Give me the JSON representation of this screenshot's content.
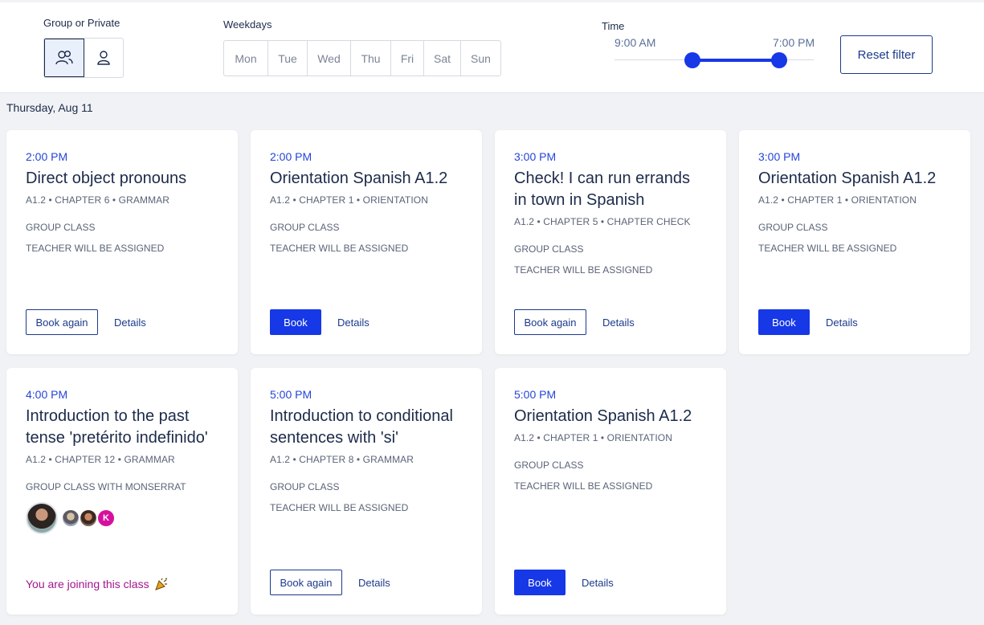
{
  "filters": {
    "mode_label": "Group or Private",
    "mode_icons": [
      "group-icon",
      "person-icon"
    ],
    "weekdays_label": "Weekdays",
    "weekdays": [
      "Mon",
      "Tue",
      "Wed",
      "Thu",
      "Fri",
      "Sat",
      "Sun"
    ],
    "time_label": "Time",
    "time_start": "9:00 AM",
    "time_end": "7:00 PM",
    "reset_label": "Reset filter"
  },
  "date_heading": "Thursday, Aug 11",
  "cards": [
    {
      "time": "2:00 PM",
      "title": "Direct object pronouns",
      "meta": "A1.2 • CHAPTER 6 • GRAMMAR",
      "type": "GROUP CLASS",
      "teacher": "TEACHER WILL BE ASSIGNED",
      "primary": "Book again",
      "details": "Details"
    },
    {
      "time": "2:00 PM",
      "title": "Orientation Spanish A1.2",
      "meta": "A1.2 • CHAPTER 1 • ORIENTATION",
      "type": "GROUP CLASS",
      "teacher": "TEACHER WILL BE ASSIGNED",
      "primary": "Book",
      "details": "Details"
    },
    {
      "time": "3:00 PM",
      "title": "Check! I can run errands in town in Spanish",
      "meta": "A1.2 • CHAPTER 5 • CHAPTER CHECK",
      "type": "GROUP CLASS",
      "teacher": "TEACHER WILL BE ASSIGNED",
      "primary": "Book again",
      "details": "Details"
    },
    {
      "time": "3:00 PM",
      "title": "Orientation Spanish A1.2",
      "meta": "A1.2 • CHAPTER 1 • ORIENTATION",
      "type": "GROUP CLASS",
      "teacher": "TEACHER WILL BE ASSIGNED",
      "primary": "Book",
      "details": "Details"
    },
    {
      "time": "4:00 PM",
      "title": "Introduction to the past tense 'pretérito indefinido'",
      "meta": "A1.2 • CHAPTER 12 • GRAMMAR",
      "type": "GROUP CLASS WITH MONSERRAT",
      "avatar_initial": "K",
      "joining": "You are joining this class"
    },
    {
      "time": "5:00 PM",
      "title": "Introduction to conditional sentences with 'si'",
      "meta": "A1.2 • CHAPTER 8 • GRAMMAR",
      "type": "GROUP CLASS",
      "teacher": "TEACHER WILL BE ASSIGNED",
      "primary": "Book again",
      "details": "Details"
    },
    {
      "time": "5:00 PM",
      "title": "Orientation Spanish A1.2",
      "meta": "A1.2 • CHAPTER 1 • ORIENTATION",
      "type": "GROUP CLASS",
      "teacher": "TEACHER WILL BE ASSIGNED",
      "primary": "Book",
      "details": "Details"
    }
  ],
  "colors": {
    "primary_button": "#1638e6",
    "time_text": "#2545d8",
    "joining_text": "#a1168c",
    "avatar_k": "#d6109e"
  }
}
